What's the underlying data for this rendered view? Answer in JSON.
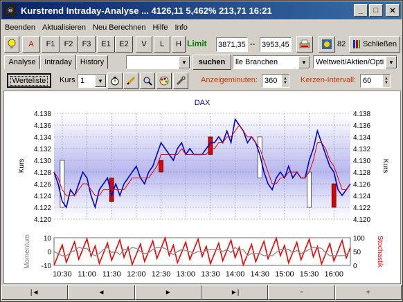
{
  "window": {
    "title": "Kurstrend Intraday-Analyse ... 4126,11  5,462%  213,71  16:21",
    "minimize_label": "_",
    "maximize_label": "□",
    "close_label": "✕"
  },
  "menu": [
    {
      "label": "Beenden"
    },
    {
      "label": "Aktualisieren"
    },
    {
      "label": "Neu Berechnen"
    },
    {
      "label": "Hilfe"
    },
    {
      "label": "Info"
    }
  ],
  "toolbar1": {
    "bulb_icon": "lightbulb-icon",
    "buttons": [
      "A",
      "F1",
      "F2",
      "F3",
      "E1",
      "E2",
      "V",
      "L",
      "H"
    ],
    "limit_label": "Limit",
    "limit_low": "3871,35",
    "limit_sep": "--",
    "limit_high": "3953,45",
    "count": "82",
    "close_label": "Schließen"
  },
  "toolbar2": {
    "tabs": [
      "Analyse",
      "Intraday",
      "History"
    ],
    "active_tab": "Intraday",
    "search_value": "",
    "search_button": "suchen",
    "branch_value": "lle Branchen",
    "region_value": "Weltweit/Aktien/Opti"
  },
  "toolbar3": {
    "watchlist_label": "Werteliste",
    "kurs_label": "Kurs",
    "kurs_value": "1",
    "minutes_label": "Anzeigeminuten:",
    "minutes_value": "360",
    "interval_label": "Kerzen-Intervall:",
    "interval_value": "60"
  },
  "chart_data": {
    "type": "line",
    "title": "DAX",
    "ylabel": "Kurs",
    "ylabel_right": "Kurs",
    "ylim": [
      4.12,
      4.138
    ],
    "yticks": [
      "4.138",
      "4.136",
      "4.134",
      "4.132",
      "4.130",
      "4.128",
      "4.126",
      "4.124",
      "4.122",
      "4.120"
    ],
    "xticks": [
      "10:30",
      "11:00",
      "11:30",
      "12:00",
      "12:30",
      "13:00",
      "13:30",
      "14:00",
      "14:30",
      "15:00",
      "15:30",
      "16:00"
    ],
    "sub_ylabel_left": "Momentum",
    "sub_ylabel_right": "Stochastik",
    "sub_yticks_left": [
      "10",
      "0",
      "-10"
    ],
    "sub_yticks_right": [
      "100",
      "50",
      "0"
    ],
    "series": [
      {
        "name": "",
        "color": "#0000cc",
        "x": [
          "10:20",
          "10:25",
          "10:30",
          "10:35",
          "10:40",
          "10:45",
          "10:50",
          "10:55",
          "11:00",
          "11:05",
          "11:10",
          "11:15",
          "11:20",
          "11:25",
          "11:30",
          "11:35",
          "11:40",
          "11:45",
          "11:50",
          "11:55",
          "12:00",
          "12:05",
          "12:10",
          "12:15",
          "12:20",
          "12:25",
          "12:30",
          "12:35",
          "12:40",
          "12:45",
          "12:50",
          "12:55",
          "13:00",
          "13:05",
          "13:10",
          "13:15",
          "13:20",
          "13:25",
          "13:30",
          "13:35",
          "13:40",
          "13:45",
          "13:50",
          "13:55",
          "14:00",
          "14:05",
          "14:10",
          "14:15",
          "14:20",
          "14:25",
          "14:30",
          "14:35",
          "14:40",
          "14:45",
          "14:50",
          "14:55",
          "15:00",
          "15:05",
          "15:10",
          "15:15",
          "15:20",
          "15:25",
          "15:30",
          "15:35",
          "15:40",
          "15:45",
          "15:50",
          "15:55",
          "16:00",
          "16:05",
          "16:10",
          "16:15",
          "16:20"
        ],
        "values": [
          4.128,
          4.126,
          4.123,
          4.122,
          4.125,
          4.124,
          4.126,
          4.128,
          4.127,
          4.124,
          4.122,
          4.125,
          4.126,
          4.127,
          4.124,
          4.126,
          4.124,
          4.126,
          4.127,
          4.128,
          4.129,
          4.127,
          4.126,
          4.128,
          4.129,
          4.131,
          4.133,
          4.132,
          4.131,
          4.13,
          4.132,
          4.133,
          4.131,
          4.132,
          4.131,
          4.131,
          4.131,
          4.132,
          4.133,
          4.133,
          4.134,
          4.133,
          4.135,
          4.133,
          4.137,
          4.136,
          4.135,
          4.133,
          4.134,
          4.133,
          4.131,
          4.128,
          4.126,
          4.125,
          4.127,
          4.128,
          4.127,
          4.129,
          4.127,
          4.128,
          4.127,
          4.127,
          4.13,
          4.132,
          4.135,
          4.133,
          4.131,
          4.129,
          4.128,
          4.125,
          4.124,
          4.125,
          4.126
        ]
      },
      {
        "name": "",
        "color": "#dd0000",
        "x": [
          "10:20",
          "10:25",
          "10:30",
          "10:35",
          "10:40",
          "10:45",
          "10:50",
          "10:55",
          "11:00",
          "11:05",
          "11:10",
          "11:15",
          "11:20",
          "11:25",
          "11:30",
          "11:35",
          "11:40",
          "11:45",
          "11:50",
          "11:55",
          "12:00",
          "12:05",
          "12:10",
          "12:15",
          "12:20",
          "12:25",
          "12:30",
          "12:35",
          "12:40",
          "12:45",
          "12:50",
          "12:55",
          "13:00",
          "13:05",
          "13:10",
          "13:15",
          "13:20",
          "13:25",
          "13:30",
          "13:35",
          "13:40",
          "13:45",
          "13:50",
          "13:55",
          "14:00",
          "14:05",
          "14:10",
          "14:15",
          "14:20",
          "14:25",
          "14:30",
          "14:35",
          "14:40",
          "14:45",
          "14:50",
          "14:55",
          "15:00",
          "15:05",
          "15:10",
          "15:15",
          "15:20",
          "15:25",
          "15:30",
          "15:35",
          "15:40",
          "15:45",
          "15:50",
          "15:55",
          "16:00",
          "16:05",
          "16:10",
          "16:15",
          "16:20"
        ],
        "values": [
          4.128,
          4.127,
          4.125,
          4.124,
          4.124,
          4.124,
          4.125,
          4.126,
          4.126,
          4.125,
          4.124,
          4.124,
          4.125,
          4.125,
          4.125,
          4.125,
          4.125,
          4.125,
          4.126,
          4.127,
          4.127,
          4.127,
          4.127,
          4.127,
          4.128,
          4.129,
          4.131,
          4.131,
          4.131,
          4.131,
          4.131,
          4.132,
          4.131,
          4.131,
          4.131,
          4.131,
          4.131,
          4.131,
          4.132,
          4.132,
          4.133,
          4.133,
          4.134,
          4.134,
          4.135,
          4.136,
          4.135,
          4.134,
          4.134,
          4.133,
          4.132,
          4.13,
          4.128,
          4.126,
          4.126,
          4.127,
          4.127,
          4.128,
          4.128,
          4.128,
          4.127,
          4.127,
          4.128,
          4.13,
          4.133,
          4.133,
          4.132,
          4.13,
          4.129,
          4.127,
          4.125,
          4.125,
          4.126
        ]
      }
    ],
    "candles": [
      {
        "x": "10:30",
        "open": 4.122,
        "close": 4.13,
        "direction": "up",
        "color": "#ffffff"
      },
      {
        "x": "11:30",
        "open": 4.127,
        "close": 4.123,
        "direction": "down",
        "color": "#dd0000"
      },
      {
        "x": "12:30",
        "open": 4.13,
        "close": 4.128,
        "direction": "down",
        "color": "#dd0000"
      },
      {
        "x": "13:30",
        "open": 4.134,
        "close": 4.131,
        "direction": "down",
        "color": "#dd0000"
      },
      {
        "x": "14:30",
        "open": 4.127,
        "close": 4.134,
        "direction": "up",
        "color": "#ffffff"
      },
      {
        "x": "15:30",
        "open": 4.122,
        "close": 4.128,
        "direction": "up",
        "color": "#ffffff"
      },
      {
        "x": "16:00",
        "open": 4.126,
        "close": 4.122,
        "direction": "down",
        "color": "#dd0000"
      }
    ]
  },
  "nav": [
    "|◄",
    "◄",
    "►",
    "►|",
    "−",
    "+"
  ]
}
